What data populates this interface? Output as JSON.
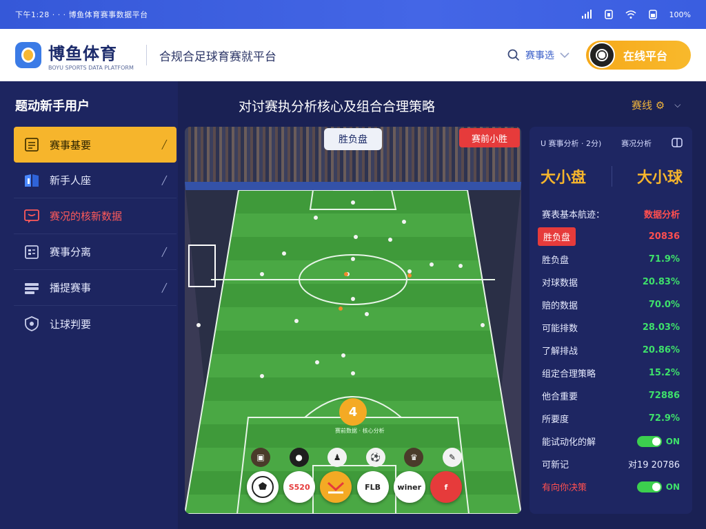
{
  "status": {
    "left_text": "下午1:28 · · · 博鱼体育赛事数据平台",
    "battery_text": "100%"
  },
  "header": {
    "brand_name": "博鱼体育",
    "brand_sub": "BOYU SPORTS DATA PLATFORM",
    "tagline": "合规合足球育赛就平台",
    "search_label": "赛事选",
    "online_button": "在线平台"
  },
  "sidebar": {
    "title": "题动新手用户",
    "items": [
      {
        "label": "赛事基要",
        "icon": "document-icon",
        "active": true
      },
      {
        "label": "新手人座",
        "icon": "book-icon",
        "active": false
      },
      {
        "label": "赛况的核新数据",
        "icon": "chat-icon",
        "active": false,
        "red": true
      },
      {
        "label": "赛事分离",
        "icon": "list-icon",
        "active": false
      },
      {
        "label": "播提赛事",
        "icon": "stack-icon",
        "active": false
      },
      {
        "label": "让球判要",
        "icon": "shield-icon",
        "active": false
      }
    ]
  },
  "main": {
    "title": "对讨赛执分析核心及组合合理策略",
    "lang_label": "赛线 ⚙"
  },
  "field": {
    "center_pill": "胜负盘",
    "corner_tag": "赛前小胜",
    "count": "4",
    "caption": "赛前数据 · 核心分析",
    "tools": [
      "ball",
      "S520",
      "chart",
      "FLB",
      "winner",
      "flag"
    ],
    "tool_labels": {
      "s520": "S520",
      "flb": "FLB",
      "winner": "winer",
      "flag": "f"
    }
  },
  "rpanel": {
    "head_left": "U 赛事分析 · 2分)",
    "head_right": "赛况分析",
    "big_left": "大小盘",
    "big_right": "大小球",
    "rows": [
      {
        "label": "赛表基本航迹：",
        "value": "数据分析",
        "style": "red"
      },
      {
        "label": "胜负盘",
        "value": "20836",
        "style": "red",
        "highlight": true
      },
      {
        "label": "胜负盘",
        "value": "71.9%",
        "style": "green"
      },
      {
        "label": "对球数据",
        "value": "20.83%",
        "style": "green"
      },
      {
        "label": "赔的数据",
        "value": "70.0%",
        "style": "green"
      },
      {
        "label": "可能排数",
        "value": "28.03%",
        "style": "green"
      },
      {
        "label": "了解排战",
        "value": "20.86%",
        "style": "green"
      },
      {
        "label": "组定合理策略",
        "value": "15.2%",
        "style": "green"
      },
      {
        "label": "他合重要",
        "value": "72886",
        "style": "green"
      },
      {
        "label": "所要度",
        "value": "72.9%",
        "style": "green"
      },
      {
        "label": "能试动化的解",
        "value": "ON",
        "style": "toggle"
      },
      {
        "label": "可新记",
        "value": "对19 20786",
        "style": "white"
      },
      {
        "label": "有向你决策",
        "value": "ON",
        "style": "toggle",
        "red_label": true
      }
    ]
  },
  "colors": {
    "accent": "#f6b52c",
    "primary": "#3558d8",
    "panel": "#1e2662",
    "danger": "#e63b3b",
    "ok": "#3ee06b"
  }
}
